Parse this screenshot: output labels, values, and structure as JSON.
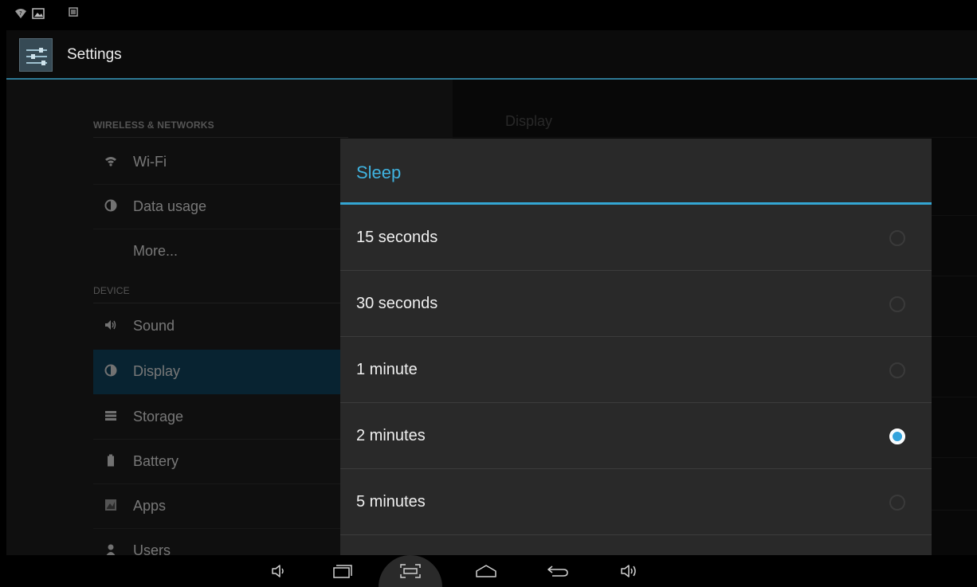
{
  "app": {
    "title": "Settings"
  },
  "status_bar": {
    "icons": [
      "wifi-question-icon",
      "image-notification-icon",
      "notification-icon"
    ]
  },
  "sidebar": {
    "sections": [
      {
        "header": "WIRELESS & NETWORKS",
        "items": [
          {
            "label": "Wi-Fi",
            "icon": "wifi-icon"
          },
          {
            "label": "Data usage",
            "icon": "data-usage-icon"
          },
          {
            "label": "More...",
            "icon": ""
          }
        ]
      },
      {
        "header": "DEVICE",
        "items": [
          {
            "label": "Sound",
            "icon": "speaker-icon"
          },
          {
            "label": "Display",
            "icon": "display-icon",
            "selected": true
          },
          {
            "label": "Storage",
            "icon": "storage-icon"
          },
          {
            "label": "Battery",
            "icon": "battery-icon"
          },
          {
            "label": "Apps",
            "icon": "apps-icon"
          },
          {
            "label": "Users",
            "icon": "users-icon"
          }
        ]
      }
    ]
  },
  "detail": {
    "title": "Display"
  },
  "dialog": {
    "title": "Sleep",
    "options": [
      {
        "label": "15 seconds",
        "checked": false
      },
      {
        "label": "30 seconds",
        "checked": false
      },
      {
        "label": "1 minute",
        "checked": false
      },
      {
        "label": "2 minutes",
        "checked": true
      },
      {
        "label": "5 minutes",
        "checked": false
      }
    ],
    "selected_value": "2 minutes"
  },
  "nav_bar": {
    "buttons": [
      "volume-down-icon",
      "recent-apps-icon",
      "screenshot-icon",
      "home-icon",
      "back-icon",
      "volume-up-icon"
    ]
  },
  "colors": {
    "accent": "#33b5e5",
    "selected_item_bg": "#10415a",
    "dialog_bg": "#292929"
  }
}
